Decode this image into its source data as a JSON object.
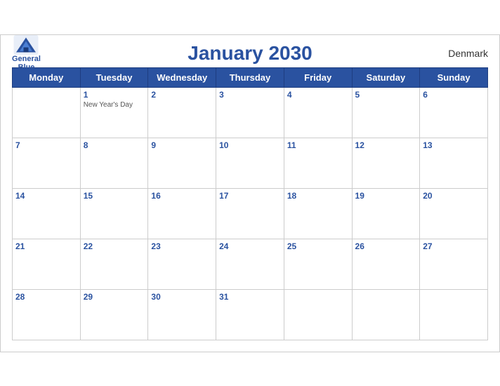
{
  "header": {
    "title": "January 2030",
    "country": "Denmark",
    "logo": {
      "line1": "General",
      "line2": "Blue"
    }
  },
  "weekdays": [
    "Monday",
    "Tuesday",
    "Wednesday",
    "Thursday",
    "Friday",
    "Saturday",
    "Sunday"
  ],
  "weeks": [
    [
      {
        "day": null,
        "holiday": null
      },
      {
        "day": "1",
        "holiday": "New Year's Day"
      },
      {
        "day": "2",
        "holiday": null
      },
      {
        "day": "3",
        "holiday": null
      },
      {
        "day": "4",
        "holiday": null
      },
      {
        "day": "5",
        "holiday": null
      },
      {
        "day": "6",
        "holiday": null
      }
    ],
    [
      {
        "day": "7",
        "holiday": null
      },
      {
        "day": "8",
        "holiday": null
      },
      {
        "day": "9",
        "holiday": null
      },
      {
        "day": "10",
        "holiday": null
      },
      {
        "day": "11",
        "holiday": null
      },
      {
        "day": "12",
        "holiday": null
      },
      {
        "day": "13",
        "holiday": null
      }
    ],
    [
      {
        "day": "14",
        "holiday": null
      },
      {
        "day": "15",
        "holiday": null
      },
      {
        "day": "16",
        "holiday": null
      },
      {
        "day": "17",
        "holiday": null
      },
      {
        "day": "18",
        "holiday": null
      },
      {
        "day": "19",
        "holiday": null
      },
      {
        "day": "20",
        "holiday": null
      }
    ],
    [
      {
        "day": "21",
        "holiday": null
      },
      {
        "day": "22",
        "holiday": null
      },
      {
        "day": "23",
        "holiday": null
      },
      {
        "day": "24",
        "holiday": null
      },
      {
        "day": "25",
        "holiday": null
      },
      {
        "day": "26",
        "holiday": null
      },
      {
        "day": "27",
        "holiday": null
      }
    ],
    [
      {
        "day": "28",
        "holiday": null
      },
      {
        "day": "29",
        "holiday": null
      },
      {
        "day": "30",
        "holiday": null
      },
      {
        "day": "31",
        "holiday": null
      },
      {
        "day": null,
        "holiday": null
      },
      {
        "day": null,
        "holiday": null
      },
      {
        "day": null,
        "holiday": null
      }
    ]
  ]
}
